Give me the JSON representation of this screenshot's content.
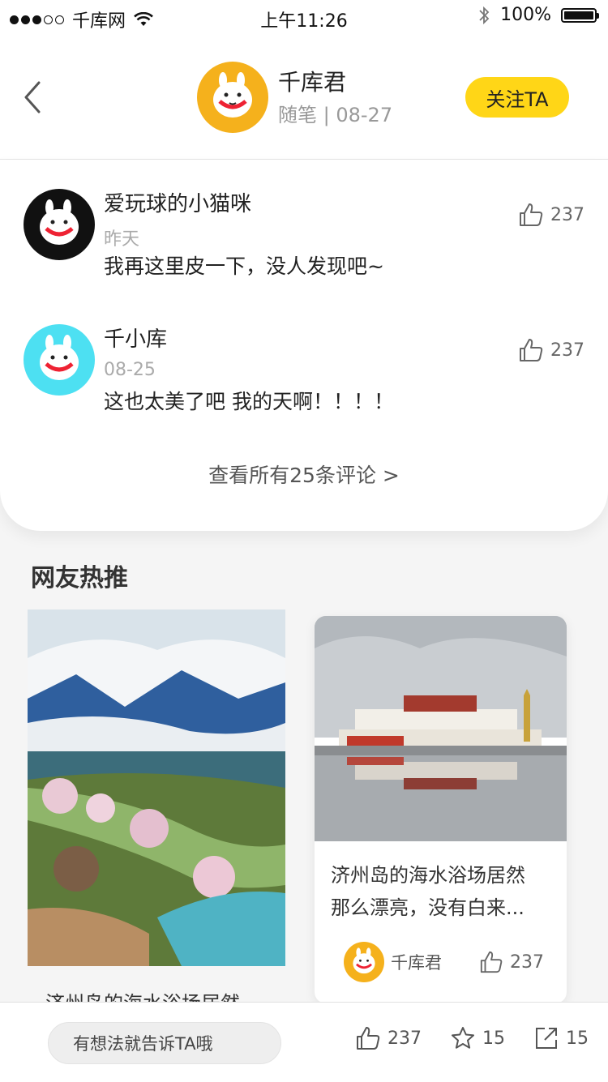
{
  "status_bar": {
    "carrier": "千库网",
    "time": "上午11:26",
    "battery": "100%",
    "battery_level": 1.0
  },
  "header": {
    "author_name": "千库君",
    "category": "随笔",
    "date": "08-27",
    "follow_label": "关注TA"
  },
  "comments": [
    {
      "name": "爱玩球的小猫咪",
      "date": "昨天",
      "text": "我再这里皮一下，没人发现吧~",
      "likes": "237",
      "avatar_color": "#111111"
    },
    {
      "name": "千小库",
      "date": "08-25",
      "text": "这也太美了吧  我的天啊！！！！",
      "likes": "237",
      "avatar_color": "#4de0f2"
    }
  ],
  "view_all": "查看所有25条评论 >",
  "recommend": {
    "title": "网友热推",
    "cards": [
      {
        "caption": "济州岛的海水浴场居然"
      },
      {
        "caption_line1": "济州岛的海水浴场居然",
        "caption_line2": "那么漂亮，没有白来...",
        "author": "千库君",
        "likes": "237"
      }
    ]
  },
  "bottom_bar": {
    "input_placeholder": "有想法就告诉TA哦",
    "likes": "237",
    "favorites": "15",
    "shares": "15"
  },
  "colors": {
    "accent": "#ffd617",
    "avatar_yellow": "#f5b11c",
    "avatar_cyan": "#4de0f2"
  }
}
